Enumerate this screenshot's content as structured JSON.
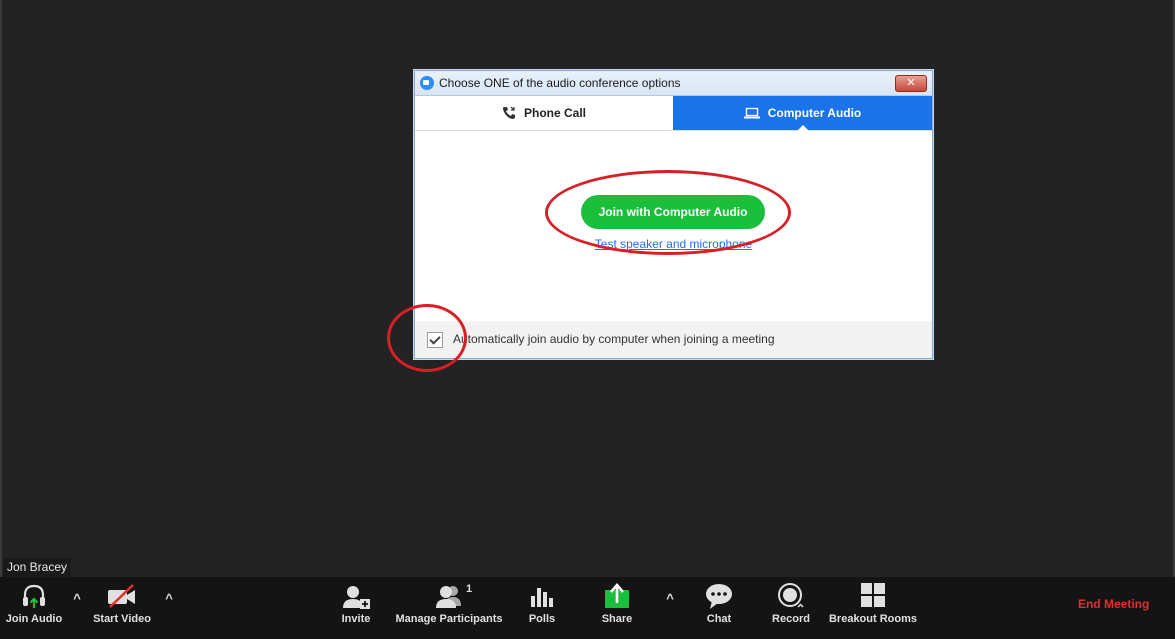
{
  "dialog": {
    "title": "Choose ONE of the audio conference options",
    "close_glyph": "✕",
    "tabs": [
      {
        "label": "Phone Call",
        "icon": "phone-icon",
        "selected": false
      },
      {
        "label": "Computer Audio",
        "icon": "laptop-icon",
        "selected": true
      }
    ],
    "join_button": "Join with Computer Audio",
    "test_link": "Test speaker and microphone",
    "auto_join_label": "Automatically join audio by computer when joining a meeting",
    "auto_join_checked": true
  },
  "participant": {
    "name": "Jon Bracey"
  },
  "toolbar": {
    "join_audio": "Join Audio",
    "start_video": "Start Video",
    "invite": "Invite",
    "manage_participants": "Manage Participants",
    "participant_count": "1",
    "polls": "Polls",
    "share": "Share",
    "chat": "Chat",
    "record": "Record",
    "breakout_rooms": "Breakout Rooms",
    "end_meeting": "End Meeting",
    "caret_glyph": "^"
  },
  "colors": {
    "accent_blue": "#1a73e8",
    "join_green": "#1cbf3c",
    "end_red": "#e0302d",
    "annotation_red": "#d81f26"
  }
}
